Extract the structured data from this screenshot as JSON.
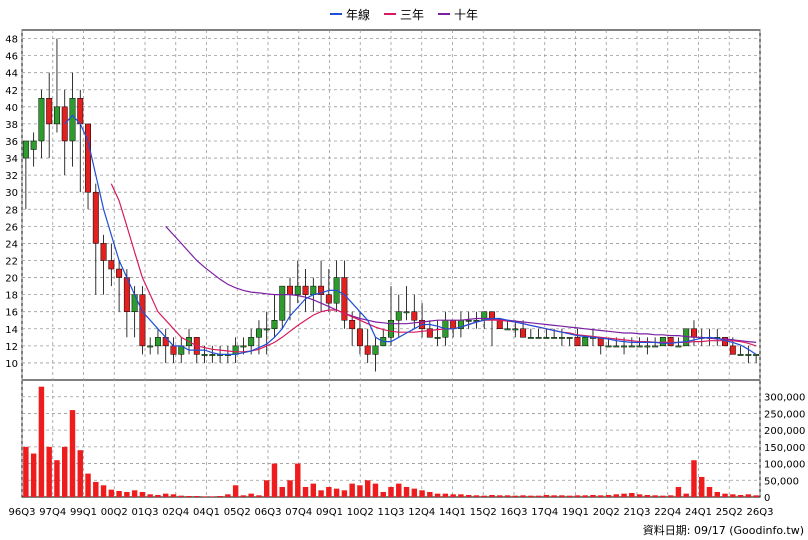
{
  "legend": {
    "year_line": "年線",
    "three_year": "三年",
    "ten_year": "十年"
  },
  "colors": {
    "year_line": "#1f4fd6",
    "three_year": "#d81b60",
    "ten_year": "#7b1fa2",
    "up": "#2e9b2e",
    "down": "#e32020",
    "volume": "#ee1c1c",
    "grid": "#9a9a9a"
  },
  "footer": "資料日期: 09/17  (Goodinfo.tw)",
  "chart_data": {
    "type": "candlestick",
    "price_axis": {
      "min": 8,
      "max": 49,
      "ticks": [
        "10",
        "12",
        "14",
        "16",
        "18",
        "20",
        "22",
        "24",
        "26",
        "28",
        "30",
        "32",
        "34",
        "36",
        "38",
        "40",
        "42",
        "44",
        "46",
        "48"
      ]
    },
    "volume_axis": {
      "min": 0,
      "max": 350000,
      "ticks": [
        "0",
        "50,000",
        "100,000",
        "150,000",
        "200,000",
        "250,000",
        "300,000"
      ]
    },
    "x_tick_labels": [
      "96Q3",
      "97Q4",
      "99Q1",
      "00Q2",
      "01Q3",
      "02Q4",
      "04Q1",
      "05Q2",
      "06Q3",
      "07Q4",
      "09Q1",
      "10Q2",
      "11Q3",
      "12Q4",
      "14Q1",
      "15Q2",
      "16Q3",
      "17Q4",
      "19Q1",
      "20Q2",
      "21Q3",
      "22Q4",
      "24Q1",
      "25Q2",
      "26Q3"
    ],
    "bars": [
      [
        34,
        36,
        28,
        36,
        150000
      ],
      [
        35,
        37,
        33,
        36,
        130000
      ],
      [
        36,
        42,
        34,
        41,
        330000
      ],
      [
        41,
        44,
        34,
        38,
        150000
      ],
      [
        38,
        48,
        37,
        40,
        110000
      ],
      [
        40,
        42,
        32,
        36,
        150000
      ],
      [
        36,
        44,
        33,
        41,
        260000
      ],
      [
        41,
        42,
        30,
        38,
        140000
      ],
      [
        38,
        37,
        28,
        30,
        70000
      ],
      [
        30,
        31,
        18,
        24,
        45000
      ],
      [
        24,
        25,
        18,
        22,
        35000
      ],
      [
        22,
        24,
        19,
        21,
        22000
      ],
      [
        21,
        22,
        16,
        20,
        18000
      ],
      [
        20,
        21,
        13,
        16,
        15000
      ],
      [
        16,
        19,
        13,
        18,
        20000
      ],
      [
        18,
        19,
        11,
        12,
        15000
      ],
      [
        12,
        13,
        11,
        12,
        8000
      ],
      [
        12,
        14,
        11,
        13,
        6000
      ],
      [
        13,
        14,
        10,
        12,
        10000
      ],
      [
        12,
        13,
        10,
        11,
        8000
      ],
      [
        11,
        13,
        10,
        12,
        4000
      ],
      [
        12,
        14,
        11,
        13,
        3000
      ],
      [
        13,
        13,
        10,
        11,
        3000
      ],
      [
        11,
        12,
        10,
        11,
        2000
      ],
      [
        11,
        12,
        10,
        11,
        2000
      ],
      [
        11,
        12,
        10,
        11,
        3000
      ],
      [
        11,
        12,
        10,
        11,
        8000
      ],
      [
        11,
        13,
        10,
        12,
        35000
      ],
      [
        12,
        13,
        11,
        12,
        5000
      ],
      [
        12,
        14,
        11,
        13,
        10000
      ],
      [
        13,
        15,
        11,
        14,
        5000
      ],
      [
        14,
        16,
        11,
        14,
        50000
      ],
      [
        14,
        18,
        13,
        15,
        100000
      ],
      [
        15,
        19,
        14,
        19,
        30000
      ],
      [
        19,
        20,
        15,
        18,
        50000
      ],
      [
        18,
        22,
        17,
        19,
        100000
      ],
      [
        19,
        21,
        16,
        18,
        30000
      ],
      [
        18,
        20,
        16,
        19,
        40000
      ],
      [
        19,
        22,
        16,
        18,
        20000
      ],
      [
        18,
        21,
        16,
        17,
        30000
      ],
      [
        17,
        22,
        16,
        20,
        25000
      ],
      [
        20,
        22,
        14,
        15,
        20000
      ],
      [
        15,
        16,
        12,
        14,
        40000
      ],
      [
        14,
        16,
        11,
        12,
        35000
      ],
      [
        12,
        14,
        10,
        11,
        50000
      ],
      [
        11,
        13,
        9,
        12,
        40000
      ],
      [
        12,
        14,
        12,
        13,
        15000
      ],
      [
        13,
        19,
        12,
        15,
        30000
      ],
      [
        15,
        18,
        13,
        16,
        40000
      ],
      [
        16,
        19,
        15,
        16,
        30000
      ],
      [
        16,
        18,
        14,
        15,
        25000
      ],
      [
        15,
        17,
        13,
        14,
        20000
      ],
      [
        14,
        15,
        13,
        13,
        15000
      ],
      [
        13,
        15,
        12,
        13,
        10000
      ],
      [
        13,
        16,
        12,
        15,
        10000
      ],
      [
        15,
        15,
        13,
        14,
        8000
      ],
      [
        14,
        16,
        13,
        15,
        8000
      ],
      [
        15,
        16,
        14,
        15,
        6000
      ],
      [
        15,
        16,
        14,
        15,
        5000
      ],
      [
        15,
        16,
        14,
        16,
        4000
      ],
      [
        16,
        16,
        12,
        15,
        6000
      ],
      [
        15,
        15,
        14,
        14,
        5000
      ],
      [
        14,
        15,
        14,
        14,
        5000
      ],
      [
        14,
        15,
        13,
        14,
        4000
      ],
      [
        14,
        15,
        13,
        13,
        5000
      ],
      [
        13,
        14,
        13,
        13,
        4000
      ],
      [
        13,
        14,
        13,
        13,
        4000
      ],
      [
        13,
        14,
        13,
        13,
        6000
      ],
      [
        13,
        14,
        13,
        13,
        5000
      ],
      [
        13,
        14,
        12,
        13,
        5000
      ],
      [
        13,
        13,
        12,
        13,
        4000
      ],
      [
        13,
        14,
        12,
        12,
        5000
      ],
      [
        12,
        13,
        12,
        13,
        5000
      ],
      [
        13,
        14,
        12,
        13,
        6000
      ],
      [
        13,
        13,
        11,
        12,
        5000
      ],
      [
        12,
        13,
        12,
        12,
        6000
      ],
      [
        12,
        13,
        12,
        12,
        8000
      ],
      [
        12,
        13,
        11,
        12,
        10000
      ],
      [
        12,
        13,
        12,
        12,
        12000
      ],
      [
        12,
        13,
        12,
        12,
        8000
      ],
      [
        12,
        13,
        11,
        12,
        6000
      ],
      [
        12,
        13,
        12,
        12,
        5000
      ],
      [
        12,
        13,
        12,
        13,
        4000
      ],
      [
        13,
        13,
        12,
        12,
        5000
      ],
      [
        12,
        13,
        12,
        12,
        30000
      ],
      [
        12,
        14,
        12,
        14,
        10000
      ],
      [
        14,
        15,
        12,
        13,
        110000
      ],
      [
        13,
        14,
        12,
        13,
        60000
      ],
      [
        13,
        14,
        12,
        13,
        30000
      ],
      [
        13,
        14,
        12,
        13,
        15000
      ],
      [
        13,
        13,
        12,
        12,
        10000
      ],
      [
        12,
        13,
        11,
        11,
        8000
      ],
      [
        11,
        12,
        11,
        11,
        6000
      ],
      [
        11,
        12,
        10,
        11,
        8000
      ],
      [
        11,
        11,
        10,
        11,
        5000
      ]
    ],
    "ma_year": [
      null,
      null,
      null,
      null,
      null,
      38,
      39,
      38,
      36,
      32,
      28,
      25,
      22,
      20,
      18,
      16,
      15,
      14,
      13,
      12,
      12,
      11.5,
      11.5,
      11.5,
      11.2,
      11,
      11,
      11,
      11.2,
      11.4,
      11.8,
      12.2,
      13,
      14,
      15.5,
      16.5,
      17.5,
      18,
      18.2,
      18.5,
      18.5,
      18,
      17,
      16,
      15,
      13,
      12.5,
      12.5,
      13,
      13.5,
      14,
      14.5,
      14.5,
      14.3,
      14,
      14,
      14.2,
      14.5,
      14.8,
      15,
      15.2,
      15.2,
      15,
      14.8,
      14.6,
      14.4,
      14.2,
      14,
      13.8,
      13.6,
      13.4,
      13.2,
      13.1,
      13,
      12.9,
      12.8,
      12.6,
      12.5,
      12.4,
      12.4,
      12.4,
      12.4,
      12.3,
      12.3,
      12.4,
      12.5,
      12.7,
      12.9,
      13,
      12.9,
      12.6,
      12.4,
      12.1,
      11.6,
      11
    ],
    "ma_three_year": [
      null,
      null,
      null,
      null,
      null,
      null,
      null,
      null,
      null,
      null,
      null,
      31,
      29,
      26,
      23,
      20,
      18,
      16,
      15,
      14,
      13,
      12.5,
      12,
      11.8,
      11.6,
      11.5,
      11.4,
      11.3,
      11.3,
      11.4,
      11.6,
      12,
      12.4,
      13,
      13.7,
      14.4,
      15,
      15.6,
      16,
      16.2,
      16.2,
      15.8,
      15.4,
      15,
      14.6,
      14.2,
      13.9,
      13.7,
      13.6,
      13.6,
      13.6,
      13.7,
      13.8,
      13.9,
      14,
      14,
      14.2,
      14.5,
      14.8,
      15,
      15,
      15,
      14.9,
      14.8,
      14.6,
      14.4,
      14.2,
      14,
      13.8,
      13.6,
      13.5,
      13.3,
      13.2,
      13.1,
      13,
      12.9,
      12.8,
      12.7,
      12.6,
      12.5,
      12.5,
      12.4,
      12.4,
      12.4,
      12.4,
      12.4,
      12.5,
      12.5,
      12.6,
      12.6,
      12.6,
      12.6,
      12.5,
      12.3,
      12
    ],
    "ma_ten_year": [
      null,
      null,
      null,
      null,
      null,
      null,
      null,
      null,
      null,
      null,
      null,
      null,
      null,
      null,
      null,
      null,
      null,
      null,
      26,
      25,
      24,
      23,
      22,
      21.2,
      20.5,
      19.8,
      19.2,
      18.8,
      18.5,
      18.3,
      18.2,
      18.1,
      18,
      18,
      18,
      17.9,
      17.7,
      17.4,
      17,
      16.6,
      16.2,
      15.8,
      15.5,
      15.2,
      15,
      14.8,
      14.7,
      14.6,
      14.6,
      14.6,
      14.7,
      14.8,
      14.9,
      15,
      15,
      15,
      15,
      15.1,
      15.2,
      15.2,
      15.2,
      15.1,
      15,
      14.9,
      14.8,
      14.7,
      14.6,
      14.5,
      14.4,
      14.3,
      14.2,
      14.1,
      14,
      13.9,
      13.8,
      13.7,
      13.6,
      13.5,
      13.5,
      13.4,
      13.4,
      13.3,
      13.3,
      13.2,
      13.2,
      13.1,
      13,
      13,
      12.9,
      12.8,
      12.8,
      12.7,
      12.6,
      12.5,
      12.4
    ]
  }
}
